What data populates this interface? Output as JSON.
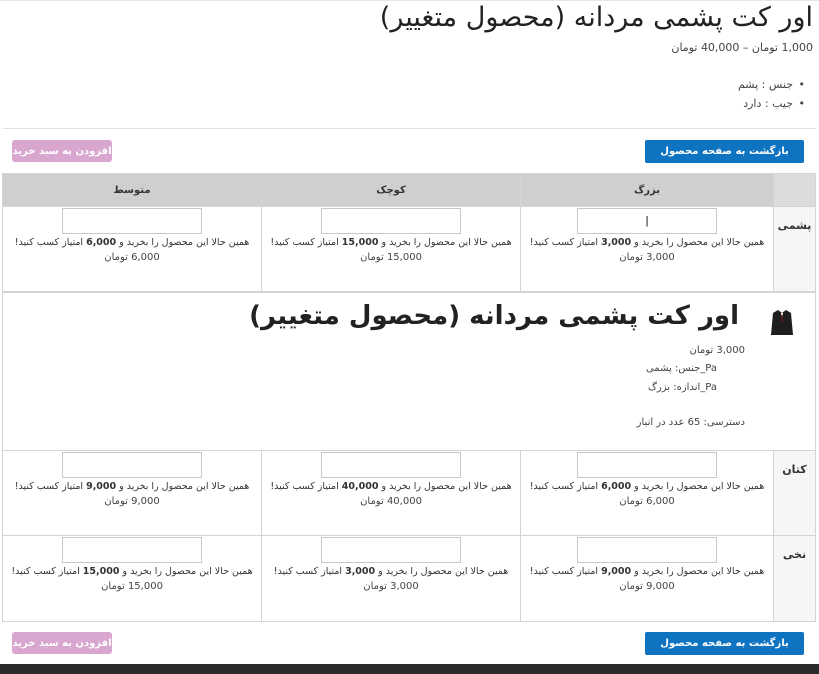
{
  "product": {
    "title": "اور کت پشمی مردانه (محصول متغییر)",
    "price_range": "1,000 تومان – 40,000 تومان",
    "attributes": [
      "جنس : پشم",
      "جیب : دارد"
    ]
  },
  "buttons": {
    "back": "بازگشت به صفحه محصول",
    "add_to_cart": "افزودن به سبد خرید"
  },
  "table": {
    "columns": [
      "بزرگ",
      "کوچک",
      "متوسط"
    ],
    "rows": [
      {
        "label": "پشمی",
        "cells": [
          {
            "points_pre": "همین حالا این محصول را بخرید و ",
            "points": "3,000",
            "points_post": " امتیاز کسب کنید!",
            "price": "3,000 تومان"
          },
          {
            "points_pre": "همین حالا این محصول را بخرید و ",
            "points": "15,000",
            "points_post": " امتیاز کسب کنید!",
            "price": "15,000 تومان"
          },
          {
            "points_pre": "همین حالا این محصول را بخرید و ",
            "points": "6,000",
            "points_post": " امتیاز کسب کنید!",
            "price": "6,000 تومان"
          }
        ]
      },
      {
        "label": "کتان",
        "cells": [
          {
            "points_pre": "همین حالا این محصول را بخرید و ",
            "points": "6,000",
            "points_post": " امتیاز کسب کنید!",
            "price": "6,000 تومان"
          },
          {
            "points_pre": "همین حالا این محصول را بخرید و ",
            "points": "40,000",
            "points_post": " امتیاز کسب کنید!",
            "price": "40,000 تومان"
          },
          {
            "points_pre": "همین حالا این محصول را بخرید و ",
            "points": "9,000",
            "points_post": " امتیاز کسب کنید!",
            "price": "9,000 تومان"
          }
        ]
      },
      {
        "label": "نخی",
        "cells": [
          {
            "points_pre": "همین حالا این محصول را بخرید و ",
            "points": "9,000",
            "points_post": " امتیاز کسب کنید!",
            "price": "9,000 تومان"
          },
          {
            "points_pre": "همین حالا این محصول را بخرید و ",
            "points": "3,000",
            "points_post": " امتیاز کسب کنید!",
            "price": "3,000 تومان"
          },
          {
            "points_pre": "همین حالا این محصول را بخرید و ",
            "points": "15,000",
            "points_post": " امتیاز کسب کنید!",
            "price": "15,000 تومان"
          }
        ]
      }
    ]
  },
  "popup": {
    "title": "اور کت پشمی مردانه (محصول متغییر)",
    "price": "3,000 تومان",
    "material": "Pa_جنس: پشمی",
    "size": "Pa_اندازه: بزرگ",
    "stock": "دسترسی: 65 عدد در انبار"
  }
}
